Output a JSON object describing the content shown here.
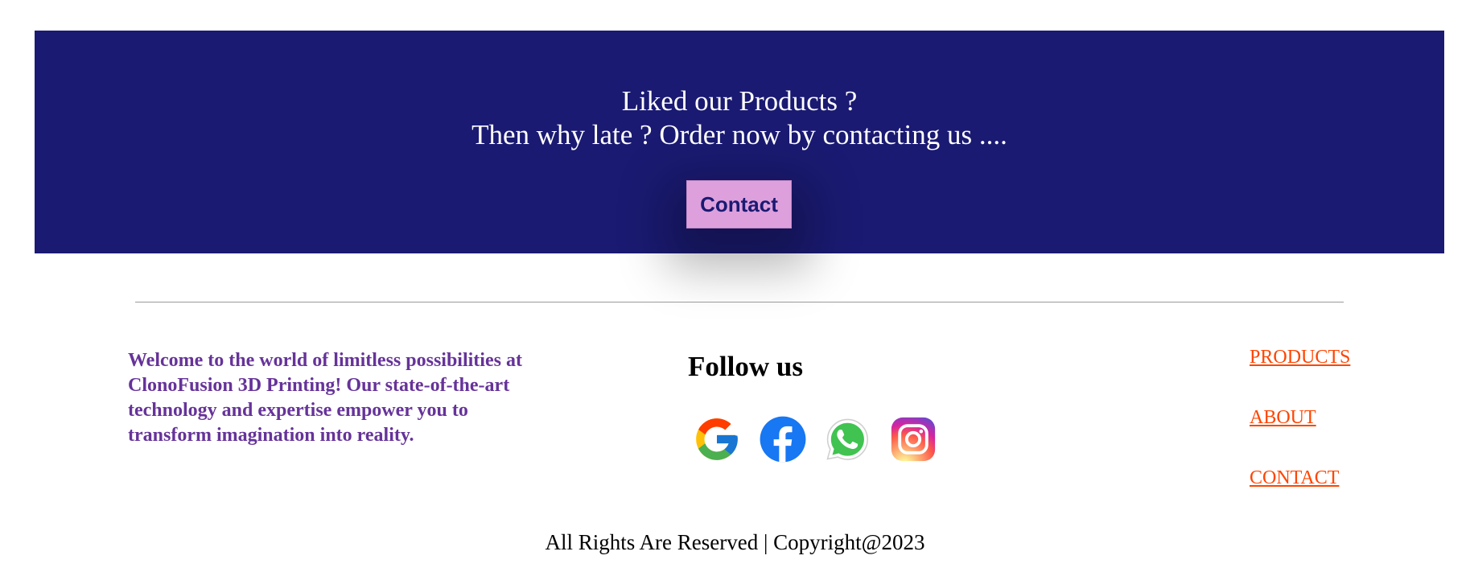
{
  "cta": {
    "line1": "Liked our Products ?",
    "line2": "Then why late ? Order now by contacting us ....",
    "button_label": "Contact",
    "band_color": "#1a1a72",
    "button_color": "#dda0dd"
  },
  "footer": {
    "about_text": "Welcome to the world of limitless possibilities at ClonoFusion 3D Printing! Our state-of-the-art technology and expertise empower you to transform imagination into reality.",
    "follow_title": "Follow us",
    "social": [
      {
        "name": "google-icon"
      },
      {
        "name": "facebook-icon"
      },
      {
        "name": "whatsapp-icon"
      },
      {
        "name": "instagram-icon"
      }
    ],
    "nav": {
      "products": "PRODUCTS",
      "about": "ABOUT",
      "contact": "CONTACT"
    },
    "copyright": "All Rights Are Reserved | Copyright@2023",
    "about_color": "#663399",
    "link_color": "#ff4500"
  }
}
